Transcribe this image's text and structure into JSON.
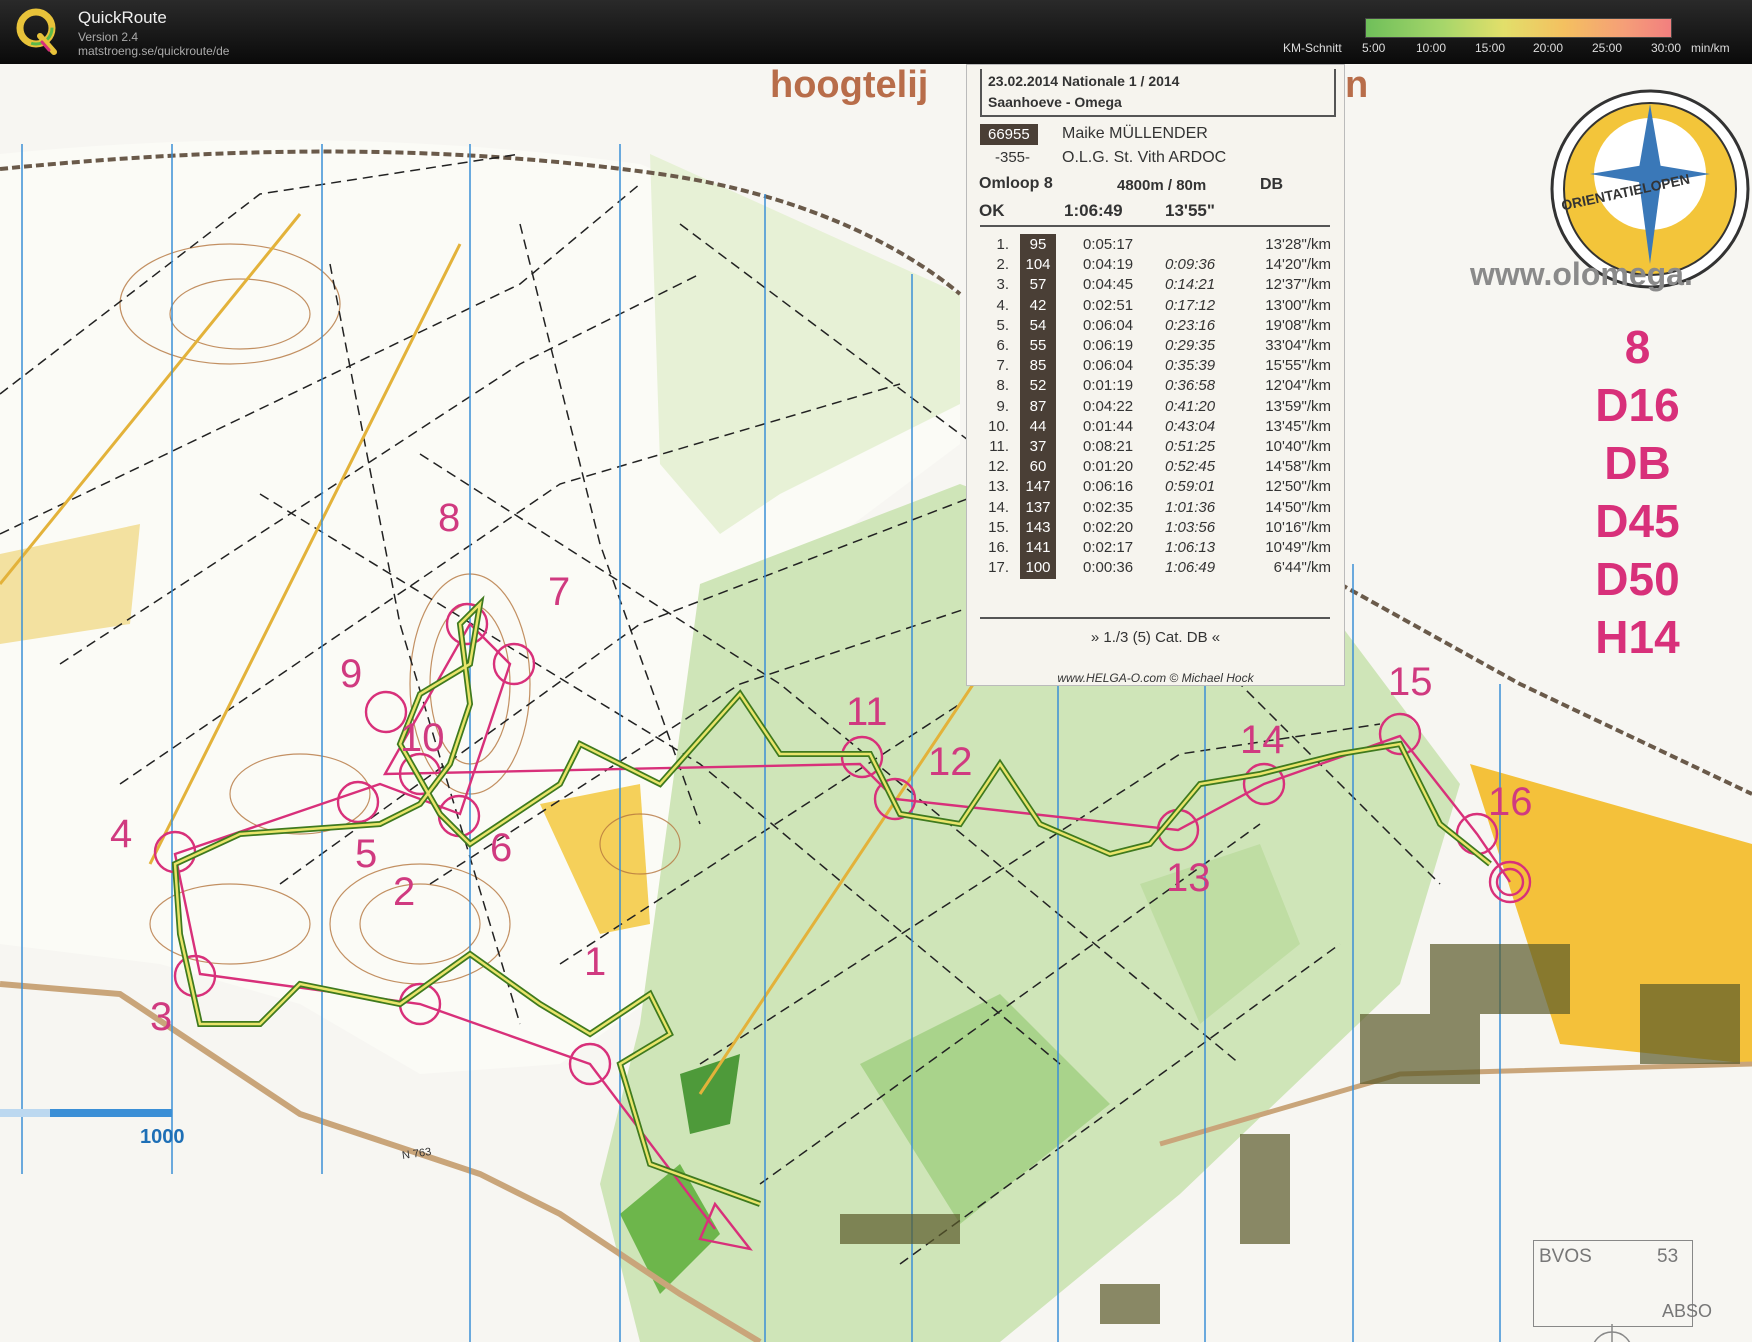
{
  "app": {
    "name": "QuickRoute",
    "version": "Version 2.4",
    "url": "matstroeng.se/quickroute/de"
  },
  "pace_legend": {
    "label": "KM-Schnitt",
    "ticks": [
      "5:00",
      "10:00",
      "15:00",
      "20:00",
      "25:00",
      "30:00"
    ],
    "unit": "min/km",
    "colors": [
      "#6fbf5a",
      "#a6d66a",
      "#e2df6a",
      "#f4c060",
      "#f59e78",
      "#f27f7f"
    ]
  },
  "map": {
    "title_start": "hoogtelij",
    "title_end": "n",
    "website": "www.olomega.",
    "club_logo_text": "ORIENTATIELOPEN",
    "scale_label": "1000",
    "road_label": "N 763",
    "sheet_code_a": "BVOS",
    "sheet_number": "53",
    "sheet_code_b": "ABSO",
    "classes": [
      "8",
      "D16",
      "DB",
      "D45",
      "D50",
      "H14"
    ],
    "control_numbers": [
      "1",
      "2",
      "3",
      "4",
      "5",
      "6",
      "7",
      "8",
      "9",
      "10",
      "11",
      "12",
      "13",
      "14",
      "15",
      "16"
    ],
    "course_color": "#d8307a",
    "route_color": "#3f7a1e"
  },
  "split_slip": {
    "date_event": "23.02.2014   Nationale 1 / 2014",
    "location": "Saanhoeve - Omega",
    "runner_id": "66955",
    "runner_name": "Maike MÜLLENDER",
    "start_no": "-355-",
    "club": "O.L.G. St. Vith ARDOC",
    "course": "Omloop 8",
    "length": "4800m / 80m",
    "category": "DB",
    "status": "OK",
    "total_time": "1:06:49",
    "avg_pace": "13'55\"",
    "splits": [
      {
        "no": "1.",
        "code": "95",
        "leg": "0:05:17",
        "cum": "",
        "pace": "13'28\"/km"
      },
      {
        "no": "2.",
        "code": "104",
        "leg": "0:04:19",
        "cum": "0:09:36",
        "pace": "14'20\"/km"
      },
      {
        "no": "3.",
        "code": "57",
        "leg": "0:04:45",
        "cum": "0:14:21",
        "pace": "12'37\"/km"
      },
      {
        "no": "4.",
        "code": "42",
        "leg": "0:02:51",
        "cum": "0:17:12",
        "pace": "13'00\"/km"
      },
      {
        "no": "5.",
        "code": "54",
        "leg": "0:06:04",
        "cum": "0:23:16",
        "pace": "19'08\"/km"
      },
      {
        "no": "6.",
        "code": "55",
        "leg": "0:06:19",
        "cum": "0:29:35",
        "pace": "33'04\"/km"
      },
      {
        "no": "7.",
        "code": "85",
        "leg": "0:06:04",
        "cum": "0:35:39",
        "pace": "15'55\"/km"
      },
      {
        "no": "8.",
        "code": "52",
        "leg": "0:01:19",
        "cum": "0:36:58",
        "pace": "12'04\"/km"
      },
      {
        "no": "9.",
        "code": "87",
        "leg": "0:04:22",
        "cum": "0:41:20",
        "pace": "13'59\"/km"
      },
      {
        "no": "10.",
        "code": "44",
        "leg": "0:01:44",
        "cum": "0:43:04",
        "pace": "13'45\"/km"
      },
      {
        "no": "11.",
        "code": "37",
        "leg": "0:08:21",
        "cum": "0:51:25",
        "pace": "10'40\"/km"
      },
      {
        "no": "12.",
        "code": "60",
        "leg": "0:01:20",
        "cum": "0:52:45",
        "pace": "14'58\"/km"
      },
      {
        "no": "13.",
        "code": "147",
        "leg": "0:06:16",
        "cum": "0:59:01",
        "pace": "12'50\"/km"
      },
      {
        "no": "14.",
        "code": "137",
        "leg": "0:02:35",
        "cum": "1:01:36",
        "pace": "14'50\"/km"
      },
      {
        "no": "15.",
        "code": "143",
        "leg": "0:02:20",
        "cum": "1:03:56",
        "pace": "10'16\"/km"
      },
      {
        "no": "16.",
        "code": "141",
        "leg": "0:02:17",
        "cum": "1:06:13",
        "pace": "10'49\"/km"
      },
      {
        "no": "17.",
        "code": "100",
        "leg": "0:00:36",
        "cum": "1:06:49",
        "pace": "6'44\"/km"
      }
    ],
    "category_rank": "» 1./3 (5) Cat. DB «",
    "footer": "www.HELGA-O.com © Michael Hock"
  }
}
